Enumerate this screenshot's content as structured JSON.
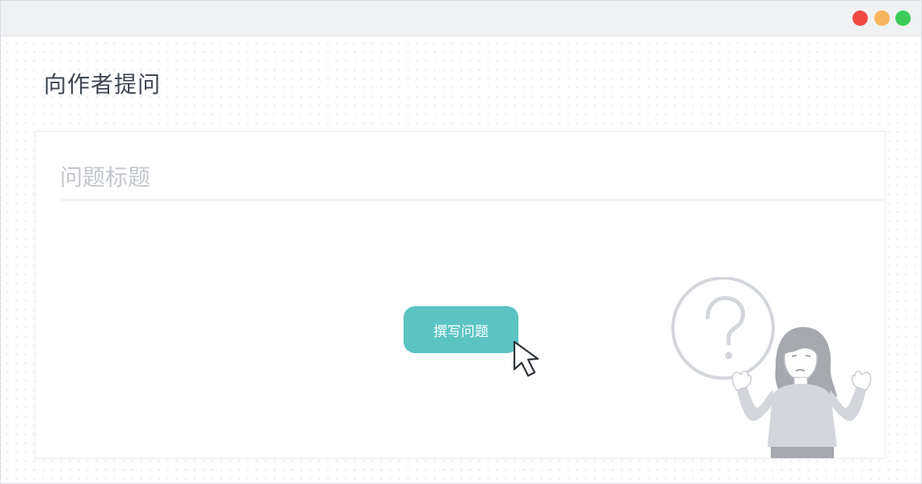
{
  "window": {
    "controls": {
      "close_color": "#f24a45",
      "minimize_color": "#f7b45c",
      "maximize_color": "#3dcc5a"
    }
  },
  "page": {
    "title": "向作者提问"
  },
  "form": {
    "title_placeholder": "问题标题",
    "title_value": "",
    "submit_label": "撰写问题",
    "accent_color": "#5bc4c2"
  },
  "icons": {
    "cursor": "arrow-cursor-icon",
    "illustration": "question-person-illustration"
  }
}
